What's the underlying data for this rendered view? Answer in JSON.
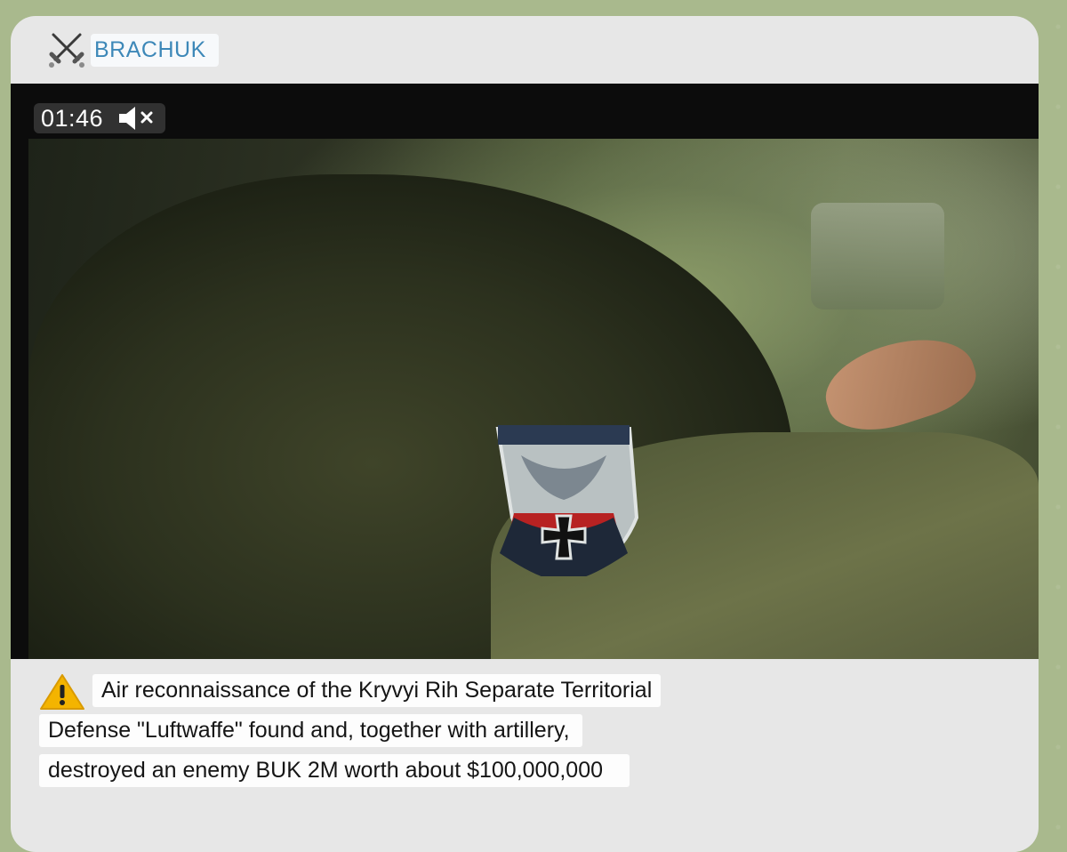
{
  "channel": {
    "name": "BRACHUK",
    "icon": "crossed-swords-icon"
  },
  "video": {
    "duration": "01:46",
    "sound_icon": "muted-speaker-icon"
  },
  "caption": {
    "icon": "warning-icon",
    "lines": [
      "Air reconnaissance of the Kryvyi Rih Separate Territorial",
      "Defense \"Luftwaffe\" found and, together with artillery,",
      "destroyed an enemy BUK 2M worth about $100,000,000"
    ]
  },
  "colors": {
    "background": "#a9b98d",
    "bubble": "#e7e7e7",
    "channel_name": "#3d88b8",
    "warning": "#f4b400"
  }
}
